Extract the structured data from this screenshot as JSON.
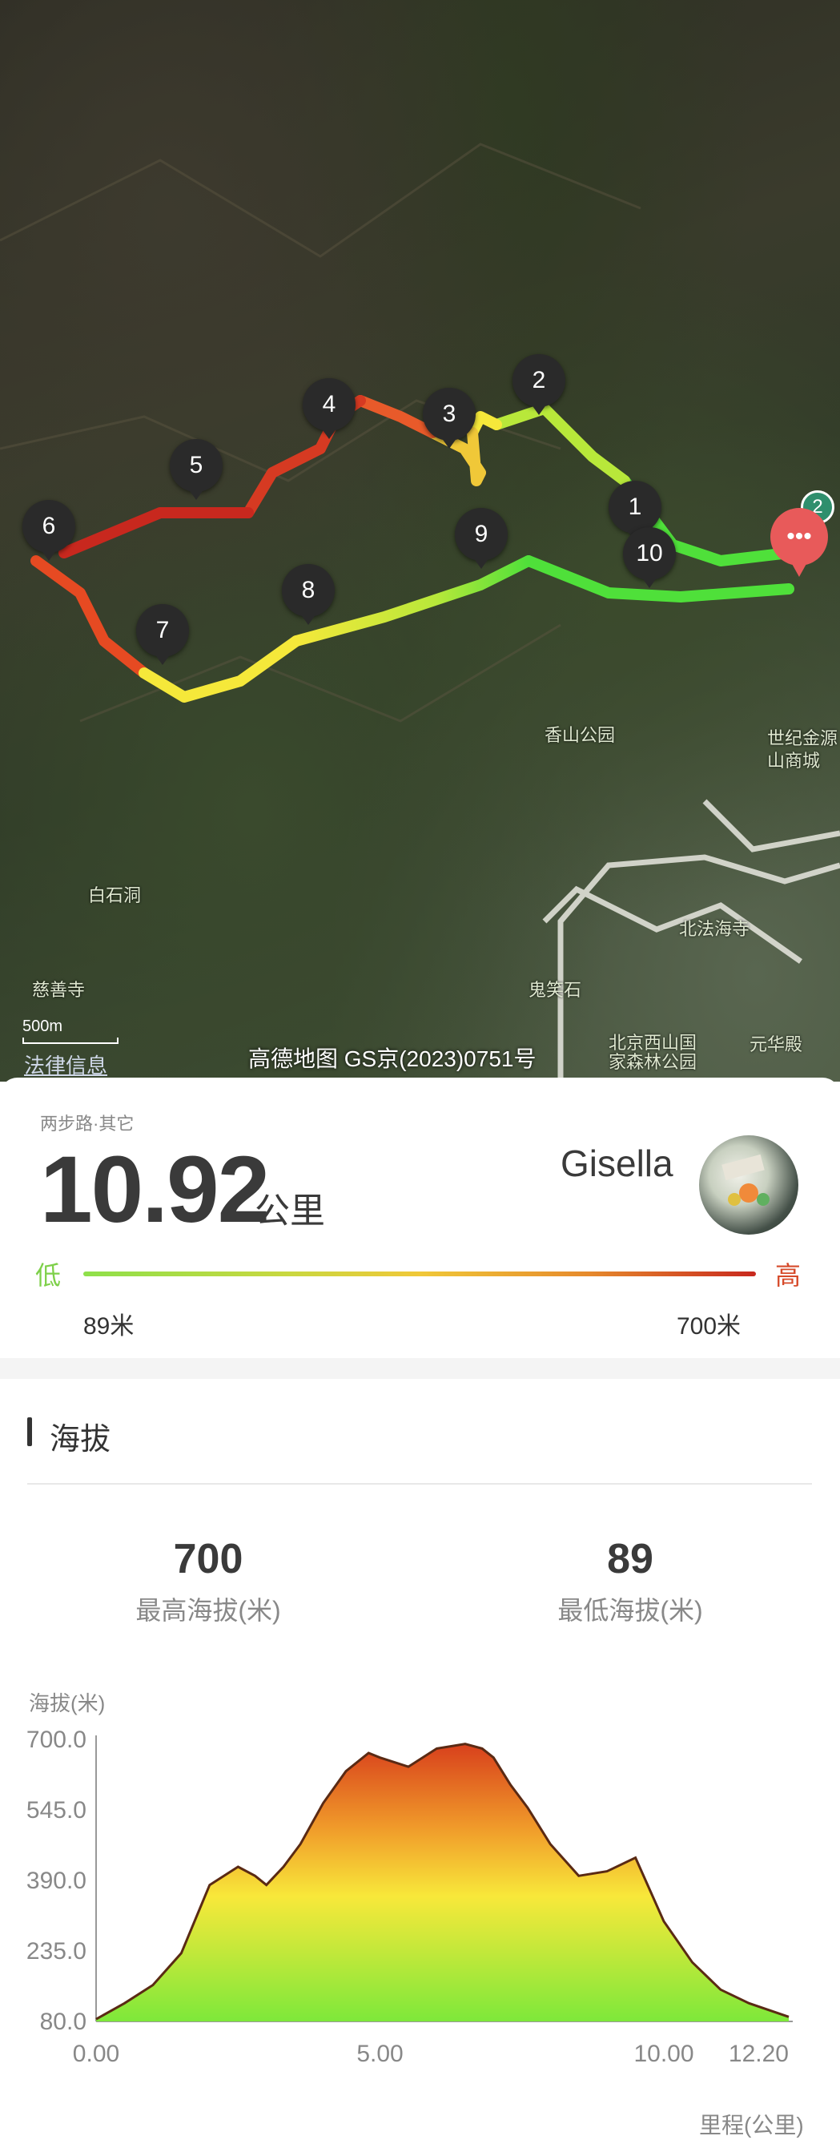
{
  "map": {
    "markers": [
      "1",
      "2",
      "3",
      "4",
      "5",
      "6",
      "7",
      "8",
      "9",
      "10"
    ],
    "labels": [
      "香山公园",
      "白石洞",
      "慈善寺",
      "鬼笑石",
      "北法海寺",
      "北京西山国家森林公园",
      "元华殿",
      "世纪金源",
      "山商城"
    ],
    "scale": "500m",
    "legal": "法律信息",
    "copyright": "高德地图 GS京(2023)0751号",
    "pin_count": "2",
    "pin_icon": "more-dots-icon"
  },
  "summary": {
    "category": "两步路·其它",
    "distance": "10.92",
    "distance_unit": "公里",
    "username": "Gisella",
    "low_label": "低",
    "high_label": "高",
    "low_value": "89米",
    "high_value": "700米",
    "low_color": "#7ed04a",
    "high_color": "#d64a2a"
  },
  "elevation": {
    "title": "海拔",
    "max_value": "700",
    "max_label": "最高海拔(米)",
    "min_value": "89",
    "min_label": "最低海拔(米)"
  },
  "chart_data": {
    "type": "area",
    "ylabel": "海拔(米)",
    "xlabel": "里程(公里)",
    "yticks": [
      "700.0",
      "545.0",
      "390.0",
      "235.0",
      "80.0"
    ],
    "xticks": [
      "0.00",
      "5.00",
      "10.00",
      "12.20"
    ],
    "ylim": [
      80,
      700
    ],
    "xlim": [
      0,
      12.2
    ],
    "x": [
      0,
      0.5,
      1.0,
      1.5,
      2.0,
      2.5,
      2.8,
      3.0,
      3.3,
      3.6,
      4.0,
      4.4,
      4.8,
      5.0,
      5.5,
      6.0,
      6.5,
      6.8,
      7.0,
      7.3,
      7.6,
      8.0,
      8.5,
      9.0,
      9.5,
      10.0,
      10.5,
      11.0,
      11.5,
      12.2
    ],
    "y": [
      85,
      120,
      160,
      230,
      380,
      420,
      400,
      380,
      420,
      470,
      560,
      630,
      670,
      660,
      640,
      680,
      690,
      680,
      660,
      600,
      550,
      470,
      400,
      410,
      440,
      300,
      210,
      150,
      120,
      90
    ]
  }
}
